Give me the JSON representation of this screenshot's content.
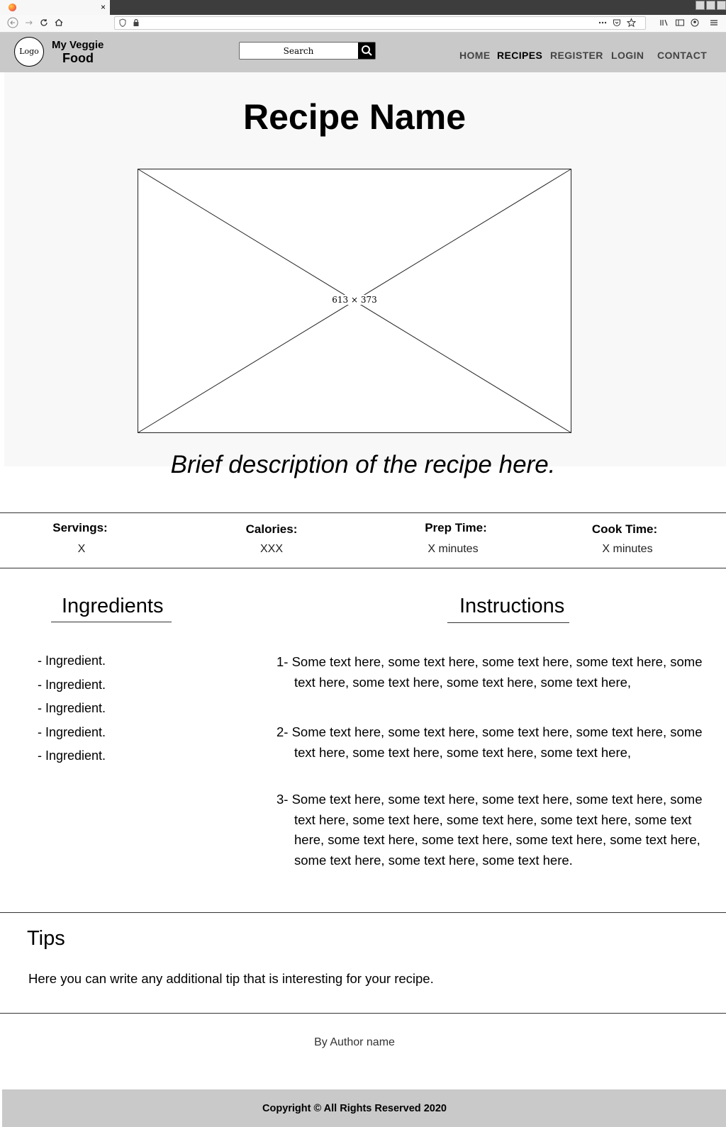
{
  "browser": {
    "tab_close": "×",
    "toolbar_icons": [
      "back-icon",
      "forward-icon",
      "reload-icon",
      "home-icon",
      "more-icon",
      "pocket-icon",
      "bookmark-star-icon",
      "library-icon",
      "sidebar-icon",
      "account-icon",
      "menu-icon"
    ]
  },
  "site": {
    "logo": "Logo",
    "brand_line1": "My Veggie",
    "brand_line2": "Food",
    "search": {
      "placeholder": "Search",
      "icon": "search-icon"
    },
    "nav": [
      "HOME",
      "RECIPES",
      "REGISTER",
      "LOGIN",
      "CONTACT"
    ],
    "nav_active": "RECIPES"
  },
  "recipe": {
    "title": "Recipe Name",
    "image_placeholder": "613 × 373",
    "description": "Brief description of the recipe here."
  },
  "stats": [
    {
      "label": "Servings:",
      "value": "X"
    },
    {
      "label": "Calories:",
      "value": "XXX"
    },
    {
      "label": "Prep Time:",
      "value": "X minutes"
    },
    {
      "label": "Cook Time:",
      "value": "X minutes"
    }
  ],
  "ingredients": {
    "heading": "Ingredients",
    "items": [
      "- Ingredient.",
      "- Ingredient.",
      "- Ingredient.",
      "- Ingredient.",
      "- Ingredient."
    ]
  },
  "instructions": {
    "heading": "Instructions",
    "steps": [
      "1- Some text here, some text here, some text here, some text here, some text here, some text here, some text here, some text here,",
      "2- Some text here, some text here, some text here, some text here, some text here, some text here, some text here, some text here,",
      "3- Some text here, some text here, some text here, some text here, some text here, some text here, some text here, some text here, some text here, some text here, some text here, some text here, some text here, some text here, some text here, some text here."
    ]
  },
  "tips": {
    "heading": "Tips",
    "text": "Here you can write any additional tip that is interesting for your recipe."
  },
  "author": "By Author name",
  "footer": {
    "copyright": "Copyright © All Rights Reserved 2020"
  }
}
